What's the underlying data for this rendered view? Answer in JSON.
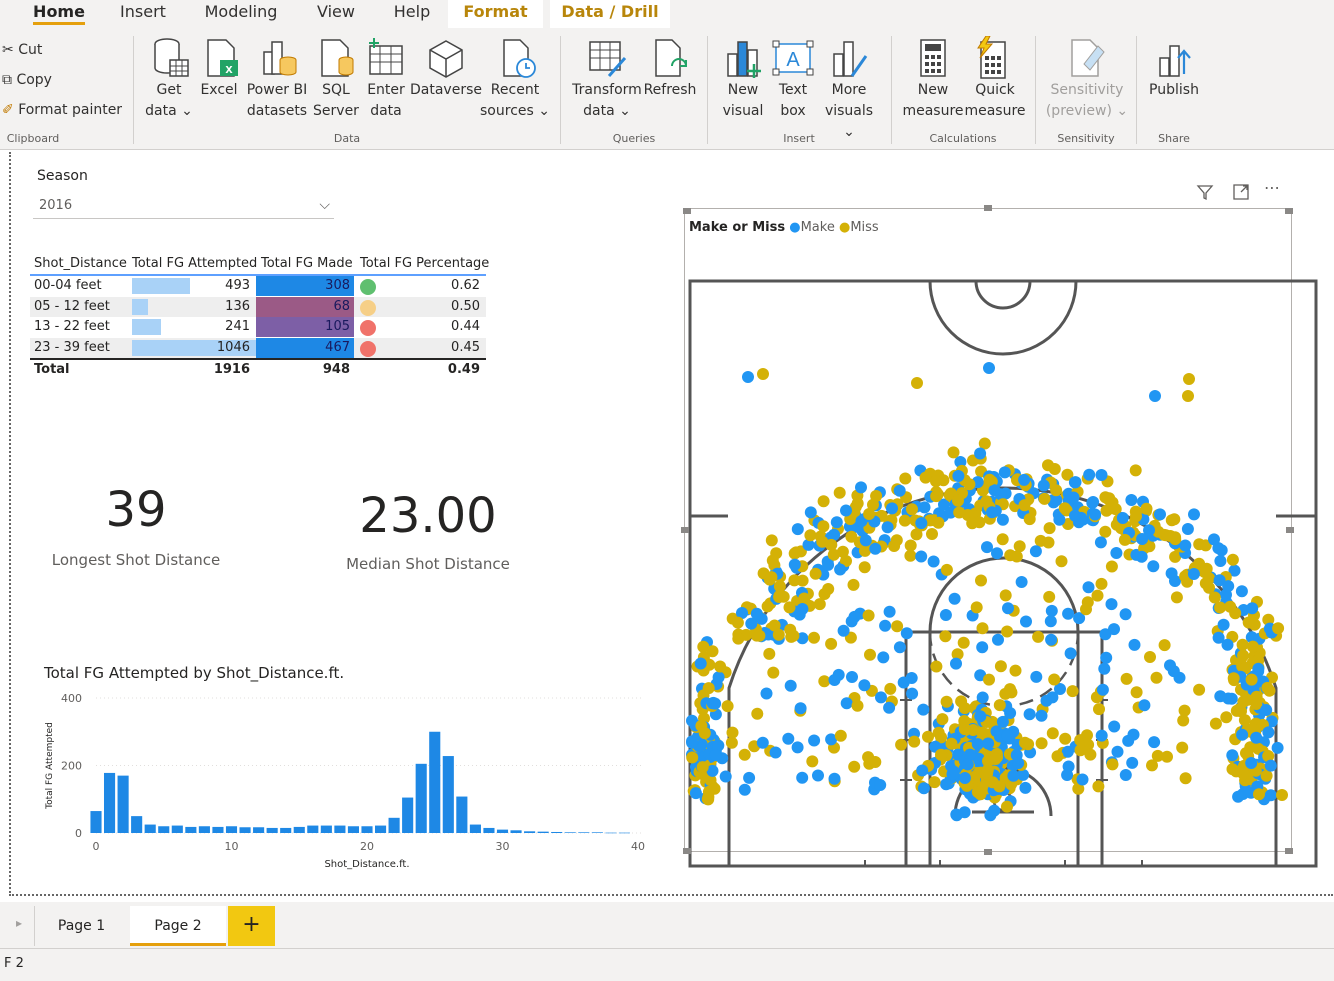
{
  "ribbon": {
    "tabs": [
      "Home",
      "Insert",
      "Modeling",
      "View",
      "Help",
      "Format",
      "Data / Drill"
    ],
    "clipboard": {
      "cut": "Cut",
      "copy": "Copy",
      "format_painter": "Format painter",
      "label": "Clipboard"
    },
    "data_group": {
      "get_data": [
        "Get",
        "data ⌄"
      ],
      "excel": [
        "Excel",
        ""
      ],
      "pbi": [
        "Power BI",
        "datasets"
      ],
      "sql": [
        "SQL",
        "Server"
      ],
      "enter": [
        "Enter",
        "data"
      ],
      "dataverse": [
        "Dataverse",
        ""
      ],
      "recent": [
        "Recent",
        "sources ⌄"
      ],
      "label": "Data"
    },
    "queries": {
      "transform": [
        "Transform",
        "data ⌄"
      ],
      "refresh": [
        "Refresh",
        ""
      ],
      "label": "Queries"
    },
    "insert": {
      "new_visual": [
        "New",
        "visual"
      ],
      "text_box": [
        "Text",
        "box"
      ],
      "more_visuals": [
        "More",
        "visuals ⌄"
      ],
      "label": "Insert"
    },
    "calculations": {
      "new_measure": [
        "New",
        "measure"
      ],
      "quick_measure": [
        "Quick",
        "measure"
      ],
      "label": "Calculations"
    },
    "sensitivity": {
      "btn": [
        "Sensitivity",
        "(preview) ⌄"
      ],
      "label": "Sensitivity"
    },
    "share": {
      "publish": "Publish",
      "label": "Share"
    }
  },
  "slicer": {
    "label": "Season",
    "value": "2016"
  },
  "table": {
    "headers": [
      "Shot_Distance",
      "Total FG Attempted",
      "Total FG Made",
      "Total FG Percentage"
    ],
    "rows": [
      {
        "dist": "00-04 feet",
        "att": "493",
        "made": "308",
        "pct": "0.62",
        "att_frac": 0.47,
        "made_color": "#1e88e5",
        "dot": "#5fbf6f"
      },
      {
        "dist": "05 - 12 feet",
        "att": "136",
        "made": "68",
        "pct": "0.50",
        "att_frac": 0.13,
        "made_color": "#9b5a86",
        "dot": "#f6cf87"
      },
      {
        "dist": "13 - 22 feet",
        "att": "241",
        "made": "105",
        "pct": "0.44",
        "att_frac": 0.23,
        "made_color": "#7d5fa6",
        "dot": "#f0726a"
      },
      {
        "dist": "23 - 39 feet",
        "att": "1046",
        "made": "467",
        "pct": "0.45",
        "att_frac": 1.0,
        "made_color": "#1e88e5",
        "dot": "#f0726a"
      }
    ],
    "total": {
      "label": "Total",
      "att": "1916",
      "made": "948",
      "pct": "0.49"
    }
  },
  "cards": [
    {
      "value": "39",
      "label": "Longest Shot Distance"
    },
    {
      "value": "23.00",
      "label": "Median Shot Distance"
    }
  ],
  "chart_data": {
    "type": "bar",
    "title": "Total FG Attempted by Shot_Distance.ft.",
    "xlabel": "Shot_Distance.ft.",
    "ylabel": "Total FG Attempted",
    "x": [
      0,
      1,
      2,
      3,
      4,
      5,
      6,
      7,
      8,
      9,
      10,
      11,
      12,
      13,
      14,
      15,
      16,
      17,
      18,
      19,
      20,
      21,
      22,
      23,
      24,
      25,
      26,
      27,
      28,
      29,
      30,
      31,
      32,
      33,
      34,
      35,
      36,
      37,
      38,
      39
    ],
    "values": [
      65,
      178,
      170,
      50,
      25,
      20,
      22,
      18,
      20,
      18,
      20,
      17,
      17,
      15,
      15,
      18,
      22,
      22,
      22,
      20,
      20,
      22,
      45,
      105,
      205,
      300,
      228,
      108,
      25,
      15,
      10,
      8,
      5,
      4,
      3,
      2,
      2,
      2,
      1,
      1
    ],
    "ylim": [
      0,
      400
    ],
    "yticks": [
      0,
      200,
      400
    ],
    "xticks": [
      0,
      10,
      20,
      30,
      40
    ],
    "color": "#1e88e5"
  },
  "court": {
    "legend_title": "Make or Miss",
    "legend": [
      {
        "name": "Make",
        "color": "#2196f3"
      },
      {
        "name": "Miss",
        "color": "#d4b106"
      }
    ]
  },
  "pages": [
    "Page 1",
    "Page 2"
  ],
  "add_page": "+",
  "status": "F 2"
}
